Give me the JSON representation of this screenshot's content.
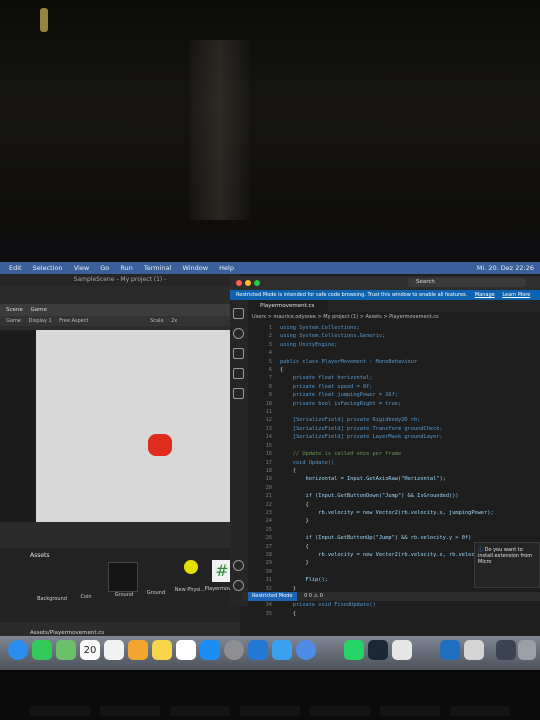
{
  "menubar": {
    "items": [
      "Edit",
      "Selection",
      "View",
      "Go",
      "Run",
      "Terminal",
      "Window",
      "Help"
    ],
    "clock": "Mi. 20. Dez 22:26"
  },
  "unity": {
    "title": "SampleScene - My project (1) -",
    "tabs": [
      "Scene",
      "Game"
    ],
    "sub": [
      "Game",
      "Display 1",
      "Free Aspect",
      "Scale",
      "2x"
    ],
    "assets_title": "Assets",
    "assets": [
      "Background",
      "Coin",
      "Ground",
      "Ground",
      "New Physi...",
      "Playermov..."
    ],
    "path": "Assets/Playermovement.cs"
  },
  "vscode": {
    "search": "Search",
    "banner": "Restricted Mode is intended for safe code browsing. Trust this window to enable all features.",
    "banner_manage": "Manage",
    "banner_learn": "Learn More",
    "tab": "Playermovement.cs",
    "breadcrumb": "Users > maurice.odyssee > My project (1) > Assets > Playermovement.cs",
    "notify": "Do you want to install extension from Micro",
    "status_mode": "Restricted Mode",
    "status_counts": "0 0 ⚠ 0",
    "code": [
      {
        "n": "1",
        "t": "using System.Collections;"
      },
      {
        "n": "2",
        "t": "using System.Collections.Generic;"
      },
      {
        "n": "3",
        "t": "using UnityEngine;"
      },
      {
        "n": "4",
        "t": ""
      },
      {
        "n": "5",
        "t": "public class PlayerMovement : MonoBehaviour"
      },
      {
        "n": "6",
        "t": "{"
      },
      {
        "n": "7",
        "t": "    private float horizontal;"
      },
      {
        "n": "8",
        "t": "    private float speed = 8f;"
      },
      {
        "n": "9",
        "t": "    private float jumpingPower = 16f;"
      },
      {
        "n": "10",
        "t": "    private bool isFacingRight = true;"
      },
      {
        "n": "11",
        "t": ""
      },
      {
        "n": "12",
        "t": "    [SerializeField] private Rigidbody2D rb;"
      },
      {
        "n": "13",
        "t": "    [SerializeField] private Transform groundCheck;"
      },
      {
        "n": "14",
        "t": "    [SerializeField] private LayerMask groundLayer;"
      },
      {
        "n": "15",
        "t": ""
      },
      {
        "n": "16",
        "t": "    // Update is called once per frame"
      },
      {
        "n": "17",
        "t": "    void Update()"
      },
      {
        "n": "18",
        "t": "    {"
      },
      {
        "n": "19",
        "t": "        horizontal = Input.GetAxisRaw(\"Horizontal\");"
      },
      {
        "n": "20",
        "t": ""
      },
      {
        "n": "21",
        "t": "        if (Input.GetButtonDown(\"Jump\") && IsGrounded())"
      },
      {
        "n": "22",
        "t": "        {"
      },
      {
        "n": "23",
        "t": "            rb.velocity = new Vector2(rb.velocity.x, jumpingPower);"
      },
      {
        "n": "24",
        "t": "        }"
      },
      {
        "n": "25",
        "t": ""
      },
      {
        "n": "26",
        "t": "        if (Input.GetButtonUp(\"Jump\") && rb.velocity.y > 0f)"
      },
      {
        "n": "27",
        "t": "        {"
      },
      {
        "n": "28",
        "t": "            rb.velocity = new Vector2(rb.velocity.x, rb.velocity.y * 0.5f);"
      },
      {
        "n": "29",
        "t": "        }"
      },
      {
        "n": "30",
        "t": ""
      },
      {
        "n": "31",
        "t": "        Flip();"
      },
      {
        "n": "32",
        "t": "    }"
      },
      {
        "n": "33",
        "t": ""
      },
      {
        "n": "34",
        "t": "    private void FixedUpdate()"
      },
      {
        "n": "35",
        "t": "    {"
      }
    ]
  },
  "dock": {
    "calendar_day": "20"
  }
}
